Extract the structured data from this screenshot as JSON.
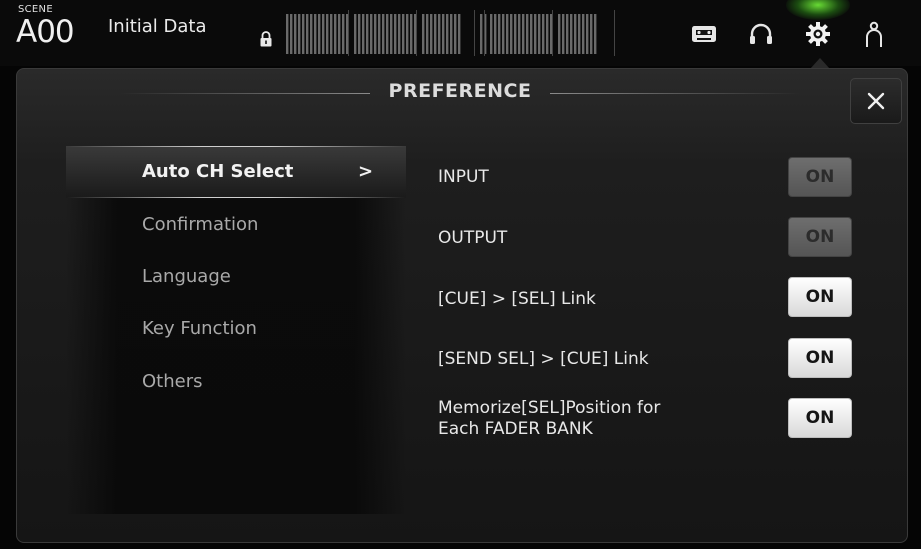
{
  "topbar": {
    "scene_label": "SCENE",
    "scene_number": "A00",
    "scene_name": "Initial Data",
    "icons": [
      "lock-icon",
      "meter-display",
      "recorder-icon",
      "headphones-icon",
      "gear-icon",
      "user-icon"
    ],
    "active_color": "#7cff3c"
  },
  "dialog": {
    "title": "PREFERENCE",
    "close_label": "×"
  },
  "menu": {
    "items": [
      {
        "label": "Auto CH Select",
        "active": true,
        "arrow": ">"
      },
      {
        "label": "Confirmation",
        "active": false
      },
      {
        "label": "Language",
        "active": false
      },
      {
        "label": "Key Function",
        "active": false
      },
      {
        "label": "Others",
        "active": false
      }
    ]
  },
  "settings": [
    {
      "label": "INPUT",
      "toggle": "ON",
      "state": "disabled"
    },
    {
      "label": "OUTPUT",
      "toggle": "ON",
      "state": "disabled"
    },
    {
      "label": "[CUE] > [SEL] Link",
      "toggle": "ON",
      "state": "on"
    },
    {
      "label": "[SEND SEL] > [CUE] Link",
      "toggle": "ON",
      "state": "on"
    },
    {
      "label": "Memorize[SEL]Position for Each FADER BANK",
      "label_line1": "Memorize[SEL]Position for",
      "label_line2": "Each FADER BANK",
      "toggle": "ON",
      "state": "on"
    }
  ]
}
